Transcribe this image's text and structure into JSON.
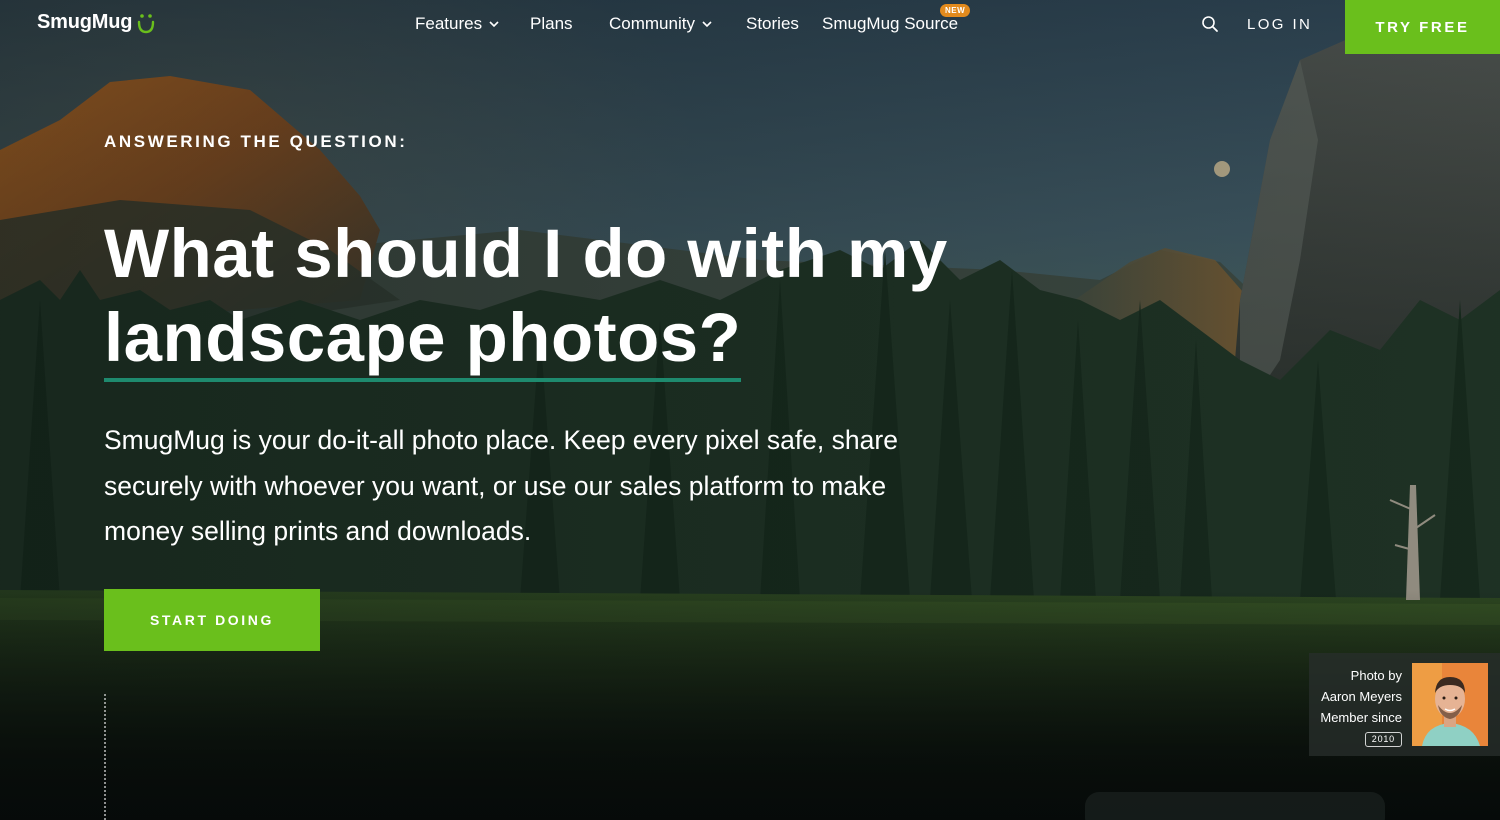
{
  "brand": {
    "name": "SmugMug",
    "logo_icon": "smugmug-face-icon"
  },
  "nav": {
    "items": [
      {
        "label": "Features",
        "has_dropdown": true
      },
      {
        "label": "Plans",
        "has_dropdown": false
      },
      {
        "label": "Community",
        "has_dropdown": true
      },
      {
        "label": "Stories",
        "has_dropdown": false
      },
      {
        "label": "SmugMug Source",
        "has_dropdown": false,
        "badge": "NEW"
      }
    ],
    "search_icon": "search-icon",
    "login_label": "LOG IN",
    "cta_label": "TRY FREE"
  },
  "hero": {
    "eyebrow": "ANSWERING THE QUESTION:",
    "headline_line1": "What should I do with my",
    "headline_line2": "landscape photos?",
    "lede": "SmugMug is your do-it-all photo place. Keep every pixel safe, share securely with whoever you want, or use our sales platform to make money selling prints and downloads.",
    "cta_label": "START DOING"
  },
  "credit": {
    "line1": "Photo by",
    "line2": "Aaron Meyers",
    "line3": "Member since",
    "year": "2010"
  },
  "colors": {
    "accent_green": "#6abf1c",
    "underline_teal": "#1e8a6e",
    "badge_orange": "#e28a1d"
  }
}
